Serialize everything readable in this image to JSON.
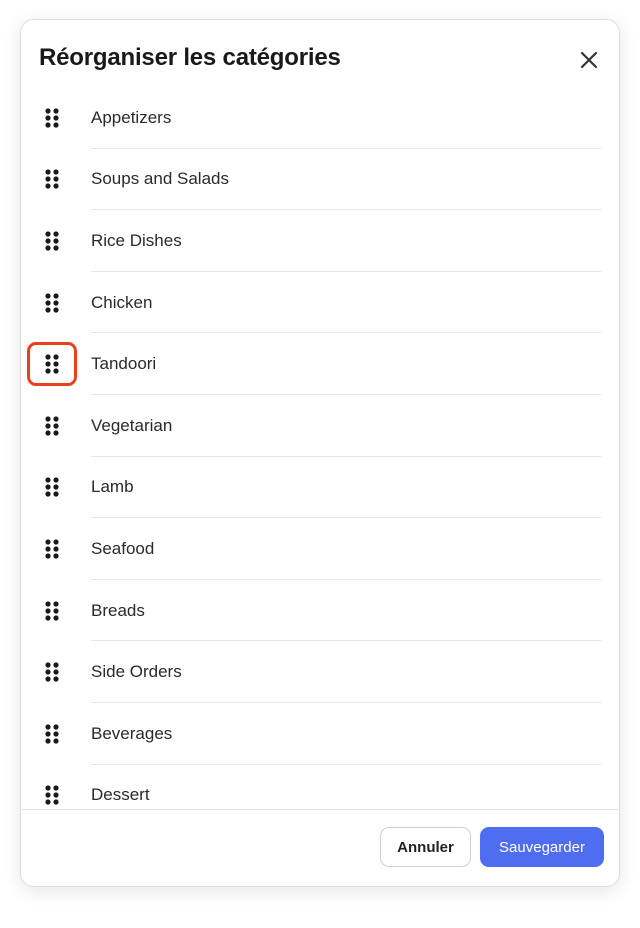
{
  "dialog": {
    "title": "Réorganiser les catégories",
    "close_icon": "close-icon"
  },
  "categories": [
    {
      "label": "Appetizers"
    },
    {
      "label": "Soups and Salads"
    },
    {
      "label": "Rice Dishes"
    },
    {
      "label": "Chicken"
    },
    {
      "label": "Tandoori"
    },
    {
      "label": "Vegetarian"
    },
    {
      "label": "Lamb"
    },
    {
      "label": "Seafood"
    },
    {
      "label": "Breads"
    },
    {
      "label": "Side Orders"
    },
    {
      "label": "Beverages"
    },
    {
      "label": "Dessert"
    }
  ],
  "highlighted_handle_label": "Tandoori",
  "drag_handle_icon": "drag-handle-icon",
  "footer": {
    "cancel_label": "Annuler",
    "save_label": "Sauvegarder"
  },
  "colors": {
    "accent": "#4f6df0",
    "highlight": "#e8401f",
    "text": "#191919",
    "divider": "#e6e6e6"
  }
}
